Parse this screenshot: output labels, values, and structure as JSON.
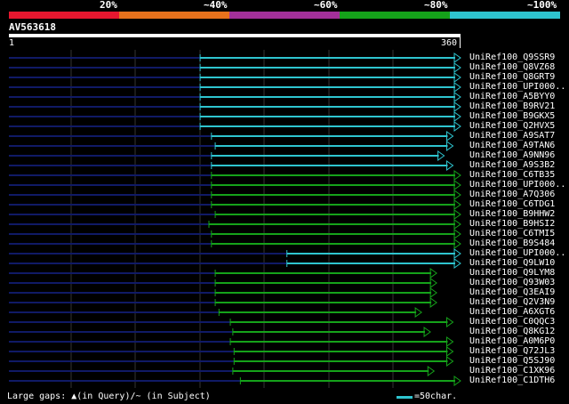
{
  "legend": {
    "labels": [
      "20%",
      "~40%",
      "~60%",
      "~80%",
      "~100%"
    ],
    "colors": [
      "#e8172f",
      "#e8721c",
      "#a3309a",
      "#15a21a",
      "#2ec4cf"
    ]
  },
  "query": {
    "name": "AV563618",
    "start": "1",
    "end": "360"
  },
  "query_length": 360,
  "hits": [
    {
      "name": "UniRef100_Q9SSR9",
      "start": 153,
      "end": 360,
      "color": "#2ec4cf"
    },
    {
      "name": "UniRef100_Q8VZ68",
      "start": 153,
      "end": 360,
      "color": "#2ec4cf"
    },
    {
      "name": "UniRef100_Q8GRT9",
      "start": 153,
      "end": 360,
      "color": "#2ec4cf"
    },
    {
      "name": "UniRef100_UPI000..",
      "start": 153,
      "end": 360,
      "color": "#2ec4cf"
    },
    {
      "name": "UniRef100_A5BYY0",
      "start": 153,
      "end": 360,
      "color": "#2ec4cf"
    },
    {
      "name": "UniRef100_B9RV21",
      "start": 153,
      "end": 360,
      "color": "#2ec4cf"
    },
    {
      "name": "UniRef100_B9GKX5",
      "start": 153,
      "end": 360,
      "color": "#2ec4cf"
    },
    {
      "name": "UniRef100_Q2HVX5",
      "start": 153,
      "end": 360,
      "color": "#2ec4cf"
    },
    {
      "name": "UniRef100_A9SAT7",
      "start": 162,
      "end": 354,
      "color": "#2ec4cf"
    },
    {
      "name": "UniRef100_A9TAN6",
      "start": 165,
      "end": 354,
      "color": "#2ec4cf"
    },
    {
      "name": "UniRef100_A9NN96",
      "start": 162,
      "end": 347,
      "color": "#2ec4cf"
    },
    {
      "name": "UniRef100_A9S3B2",
      "start": 162,
      "end": 354,
      "color": "#2ec4cf"
    },
    {
      "name": "UniRef100_C6TB35",
      "start": 162,
      "end": 360,
      "color": "#15a21a"
    },
    {
      "name": "UniRef100_UPI000..",
      "start": 162,
      "end": 360,
      "color": "#15a21a"
    },
    {
      "name": "UniRef100_A7Q306",
      "start": 162,
      "end": 360,
      "color": "#15a21a"
    },
    {
      "name": "UniRef100_C6TDG1",
      "start": 162,
      "end": 360,
      "color": "#15a21a"
    },
    {
      "name": "UniRef100_B9HHW2",
      "start": 165,
      "end": 360,
      "color": "#15a21a"
    },
    {
      "name": "UniRef100_B9HSI2",
      "start": 160,
      "end": 360,
      "color": "#15a21a"
    },
    {
      "name": "UniRef100_C6TMI5",
      "start": 162,
      "end": 360,
      "color": "#15a21a"
    },
    {
      "name": "UniRef100_B9S484",
      "start": 162,
      "end": 360,
      "color": "#15a21a"
    },
    {
      "name": "UniRef100_UPI000..",
      "start": 222,
      "end": 360,
      "color": "#2ec4cf"
    },
    {
      "name": "UniRef100_Q9LW10",
      "start": 222,
      "end": 360,
      "color": "#2ec4cf"
    },
    {
      "name": "UniRef100_Q9LYM8",
      "start": 165,
      "end": 341,
      "color": "#15a21a"
    },
    {
      "name": "UniRef100_Q93W03",
      "start": 165,
      "end": 341,
      "color": "#15a21a"
    },
    {
      "name": "UniRef100_Q3EAI9",
      "start": 165,
      "end": 341,
      "color": "#15a21a"
    },
    {
      "name": "UniRef100_Q2V3N9",
      "start": 165,
      "end": 341,
      "color": "#15a21a"
    },
    {
      "name": "UniRef100_A6XGT6",
      "start": 168,
      "end": 329,
      "color": "#15a21a"
    },
    {
      "name": "UniRef100_C0QQC3",
      "start": 177,
      "end": 354,
      "color": "#15a21a"
    },
    {
      "name": "UniRef100_Q8KG12",
      "start": 179,
      "end": 336,
      "color": "#15a21a"
    },
    {
      "name": "UniRef100_A0M6P0",
      "start": 177,
      "end": 354,
      "color": "#15a21a"
    },
    {
      "name": "UniRef100_Q72JL3",
      "start": 180,
      "end": 354,
      "color": "#15a21a"
    },
    {
      "name": "UniRef100_Q5SJ90",
      "start": 180,
      "end": 354,
      "color": "#15a21a"
    },
    {
      "name": "UniRef100_C1XK96",
      "start": 179,
      "end": 339,
      "color": "#15a21a"
    },
    {
      "name": "UniRef100_C1DTH6",
      "start": 185,
      "end": 360,
      "color": "#15a21a"
    }
  ],
  "grid_color": "#333333",
  "track_color": "#101a66",
  "footer": {
    "gaps_text": "Large gaps: ▲(in Query)/~ (in Subject)",
    "scale_text": "=50char."
  }
}
